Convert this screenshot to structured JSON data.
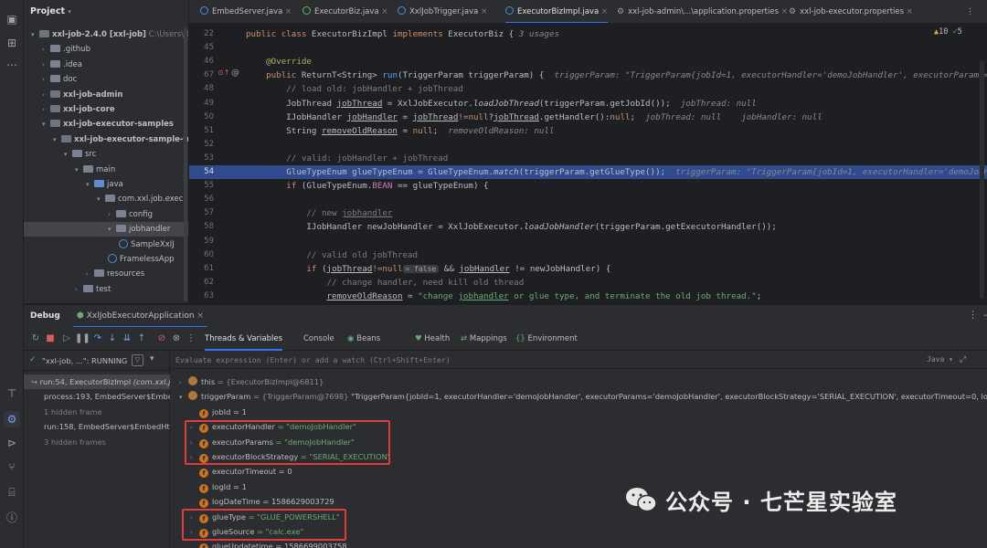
{
  "project": {
    "title": "Project",
    "tree": [
      {
        "label": "xxl-job-2.4.0 [xxl-job]",
        "hint": "C:\\Users\\Red",
        "kind": "mod",
        "indent": 0,
        "open": true
      },
      {
        "label": ".github",
        "kind": "folder",
        "indent": 1,
        "open": false
      },
      {
        "label": ".idea",
        "kind": "folder",
        "indent": 1,
        "open": false
      },
      {
        "label": "doc",
        "kind": "folder",
        "indent": 1,
        "open": false
      },
      {
        "label": "xxl-job-admin",
        "kind": "mod",
        "indent": 1,
        "open": false
      },
      {
        "label": "xxl-job-core",
        "kind": "mod",
        "indent": 1,
        "open": false
      },
      {
        "label": "xxl-job-executor-samples",
        "kind": "mod",
        "indent": 1,
        "open": true
      },
      {
        "label": "xxl-job-executor-sample-fram",
        "kind": "mod",
        "indent": 2,
        "open": true
      },
      {
        "label": "src",
        "kind": "folder",
        "indent": 3,
        "open": true
      },
      {
        "label": "main",
        "kind": "folder",
        "indent": 4,
        "open": true
      },
      {
        "label": "java",
        "kind": "blue",
        "indent": 5,
        "open": true
      },
      {
        "label": "com.xxl.job.execut",
        "kind": "folder",
        "indent": 6,
        "open": true
      },
      {
        "label": "config",
        "kind": "folder",
        "indent": 7,
        "open": false
      },
      {
        "label": "jobhandler",
        "kind": "folder",
        "indent": 7,
        "open": true,
        "selected": true
      },
      {
        "label": "SampleXxlJ",
        "kind": "class",
        "indent": 8
      },
      {
        "label": "FramelessApp",
        "kind": "class",
        "indent": 7
      },
      {
        "label": "resources",
        "kind": "folder",
        "indent": 5,
        "open": false
      },
      {
        "label": "test",
        "kind": "folder",
        "indent": 4,
        "open": false
      }
    ]
  },
  "tabs": [
    {
      "label": "EmbedServer.java",
      "icon": "class"
    },
    {
      "label": "ExecutorBiz.java",
      "icon": "interface"
    },
    {
      "label": "XxlJobTrigger.java",
      "icon": "class"
    },
    {
      "label": "ExecutorBizImpl.java",
      "icon": "class",
      "active": true
    },
    {
      "label": "xxl-job-admin\\...\\application.properties",
      "icon": "gear"
    },
    {
      "label": "xxl-job-executor.properties",
      "icon": "gear"
    }
  ],
  "editor": {
    "inspections": {
      "warnings": "10",
      "weak": "5"
    },
    "lines": [
      {
        "n": "22",
        "parts": [
          [
            "kw",
            "public class "
          ],
          [
            "",
            "ExecutorBizImpl "
          ],
          [
            "kw",
            "implements "
          ],
          [
            "",
            "ExecutorBiz { "
          ],
          [
            "hint",
            "3 usages"
          ]
        ]
      },
      {
        "n": "45",
        "parts": []
      },
      {
        "n": "46",
        "parts": [
          [
            "ann",
            "    @Override"
          ]
        ]
      },
      {
        "n": "67",
        "parts": [
          [
            "kw",
            "    public "
          ],
          [
            "",
            "ReturnT<String> "
          ],
          [
            "fn",
            "run"
          ],
          [
            "",
            "(TriggerParam triggerParam) {  "
          ],
          [
            "hint",
            "triggerParam: \"TriggerParam{jobId=1, executorHandler='demoJobHandler', executorParams='"
          ]
        ]
      },
      {
        "n": "48",
        "parts": [
          [
            "cm",
            "        // load old: jobHandler + jobThread"
          ]
        ]
      },
      {
        "n": "49",
        "parts": [
          [
            "",
            "        JobThread "
          ],
          [
            "ul",
            "jobThread"
          ],
          [
            "",
            " = XxlJobExecutor."
          ],
          [
            "it",
            "loadJobThread"
          ],
          [
            "",
            "(triggerParam.getJobId());  "
          ],
          [
            "hint",
            "jobThread: null"
          ]
        ]
      },
      {
        "n": "50",
        "parts": [
          [
            "",
            "        IJobHandler "
          ],
          [
            "ul",
            "jobHandler"
          ],
          [
            "",
            " = "
          ],
          [
            "ul",
            "jobThread"
          ],
          [
            "kw",
            "!=null"
          ],
          [
            "",
            "?"
          ],
          [
            "ul",
            "jobThread"
          ],
          [
            "",
            ".getHandler():"
          ],
          [
            "kw",
            "null"
          ],
          [
            "",
            ";  "
          ],
          [
            "hint",
            "jobThread: null    jobHandler: null"
          ]
        ]
      },
      {
        "n": "51",
        "parts": [
          [
            "",
            "        String "
          ],
          [
            "ul",
            "removeOldReason"
          ],
          [
            "",
            " = "
          ],
          [
            "kw",
            "null"
          ],
          [
            "",
            ";  "
          ],
          [
            "hint",
            "removeOldReason: null"
          ]
        ]
      },
      {
        "n": "52",
        "parts": []
      },
      {
        "n": "53",
        "parts": [
          [
            "cm",
            "        // valid: jobHandler + jobThread"
          ]
        ]
      },
      {
        "n": "54",
        "hl": true,
        "parts": [
          [
            "",
            "        GlueTypeEnum glueTypeEnum = GlueTypeEnum."
          ],
          [
            "it",
            "match"
          ],
          [
            "",
            "(triggerParam.getGlueType());  "
          ],
          [
            "hint",
            "triggerParam: \"TriggerParam{jobId=1, executorHandler='demoJobHa"
          ]
        ]
      },
      {
        "n": "55",
        "parts": [
          [
            "kw",
            "        if "
          ],
          [
            "",
            "(GlueTypeEnum."
          ],
          [
            "var",
            "BEAN"
          ],
          [
            "",
            " == glueTypeEnum) {"
          ]
        ]
      },
      {
        "n": "56",
        "parts": []
      },
      {
        "n": "57",
        "parts": [
          [
            "cm",
            "            // new "
          ],
          [
            "cm ul",
            "jobhandler"
          ]
        ]
      },
      {
        "n": "58",
        "parts": [
          [
            "",
            "            IJobHandler newJobHandler = XxlJobExecutor."
          ],
          [
            "it",
            "loadJobHandler"
          ],
          [
            "",
            "(triggerParam.getExecutorHandler());"
          ]
        ]
      },
      {
        "n": "59",
        "parts": []
      },
      {
        "n": "60",
        "parts": [
          [
            "cm",
            "            // valid old jobThread"
          ]
        ]
      },
      {
        "n": "61",
        "parts": [
          [
            "kw",
            "            if "
          ],
          [
            "",
            "("
          ],
          [
            "ul",
            "jobThread"
          ],
          [
            "kw",
            "!=null"
          ],
          [
            "inlay",
            "= false"
          ],
          [
            "",
            " && "
          ],
          [
            "ul",
            "jobHandler"
          ],
          [
            "",
            " != newJobHandler) {"
          ]
        ]
      },
      {
        "n": "62",
        "parts": [
          [
            "cm",
            "                // change handler, need kill old thread"
          ]
        ]
      },
      {
        "n": "63",
        "parts": [
          [
            "",
            "                "
          ],
          [
            "ul",
            "removeOldReason"
          ],
          [
            "",
            " = "
          ],
          [
            "str",
            "\"change "
          ],
          [
            "str ul",
            "jobhandler"
          ],
          [
            "str",
            " or glue type, and terminate the old job thread.\""
          ],
          [
            "",
            ";"
          ]
        ]
      }
    ]
  },
  "debug": {
    "title": "Debug",
    "config": "XxlJobExecutorApplication",
    "tabs": [
      "Threads & Variables",
      "Console",
      "Beans",
      "Health",
      "Mappings",
      "Environment"
    ],
    "thread": "\"xxl-job, ...\": RUNNING",
    "eval_placeholder": "Evaluate expression (Enter) or add a watch (Ctrl+Shift+Enter)",
    "lang": "Java",
    "frames": [
      {
        "label": "run:54, ExecutorBizImpl",
        "detail": " (com.xxl.jo",
        "selected": true
      },
      {
        "label": "process:193, EmbedServer$Embed",
        "detail": ""
      },
      {
        "label": "1 hidden frame",
        "detail": "",
        "dim": true
      },
      {
        "label": "run:158, EmbedServer$EmbedHttp",
        "detail": ""
      },
      {
        "label": "3 hidden frames",
        "detail": "",
        "dim": true
      }
    ],
    "vars": [
      {
        "indent": 0,
        "arrow": true,
        "icon": "p",
        "name": "this",
        "val": " = {ExecutorBizImpl@6811}",
        "vt": "gray"
      },
      {
        "indent": 0,
        "arrow": true,
        "open": true,
        "icon": "p",
        "name": "triggerParam",
        "val": " = {TriggerParam@7698} ",
        "vt": "gray",
        "extra": "\"TriggerParam{jobId=1, executorHandler='demoJobHandler', executorParams='demoJobHandler', executorBlockStrategy='SERIAL_EXECUTION', executorTimeout=0, logId=",
        "link": "... View"
      },
      {
        "indent": 1,
        "icon": "f",
        "name": "jobId",
        "val": " = 1",
        "vt": "num"
      },
      {
        "indent": 1,
        "arrow": true,
        "icon": "f",
        "name": "executorHandler",
        "val": " = \"demoJobHandler\"",
        "vt": "str"
      },
      {
        "indent": 1,
        "arrow": true,
        "icon": "f",
        "name": "executorParams",
        "val": " = \"demoJobHandler\"",
        "vt": "str"
      },
      {
        "indent": 1,
        "arrow": true,
        "icon": "f",
        "name": "executorBlockStrategy",
        "val": " = \"SERIAL_EXECUTION\"",
        "vt": "str"
      },
      {
        "indent": 1,
        "icon": "f",
        "name": "executorTimeout",
        "val": " = 0",
        "vt": "num"
      },
      {
        "indent": 1,
        "icon": "f",
        "name": "logId",
        "val": " = 1",
        "vt": "num"
      },
      {
        "indent": 1,
        "icon": "f",
        "name": "logDateTime",
        "val": " = 1586629003729",
        "vt": "num"
      },
      {
        "indent": 1,
        "arrow": true,
        "icon": "f",
        "name": "glueType",
        "val": " = \"GLUE_POWERSHELL\"",
        "vt": "str"
      },
      {
        "indent": 1,
        "arrow": true,
        "icon": "f",
        "name": "glueSource",
        "val": " = \"calc.exe\"",
        "vt": "str"
      },
      {
        "indent": 1,
        "icon": "f",
        "name": "glueUpdatetime",
        "val": " = 1586699003758",
        "vt": "num"
      }
    ]
  },
  "watermark": "公众号 · 七芒星实验室",
  "colors": {
    "highlight": "#e23b3b",
    "accent": "#3574f0"
  }
}
